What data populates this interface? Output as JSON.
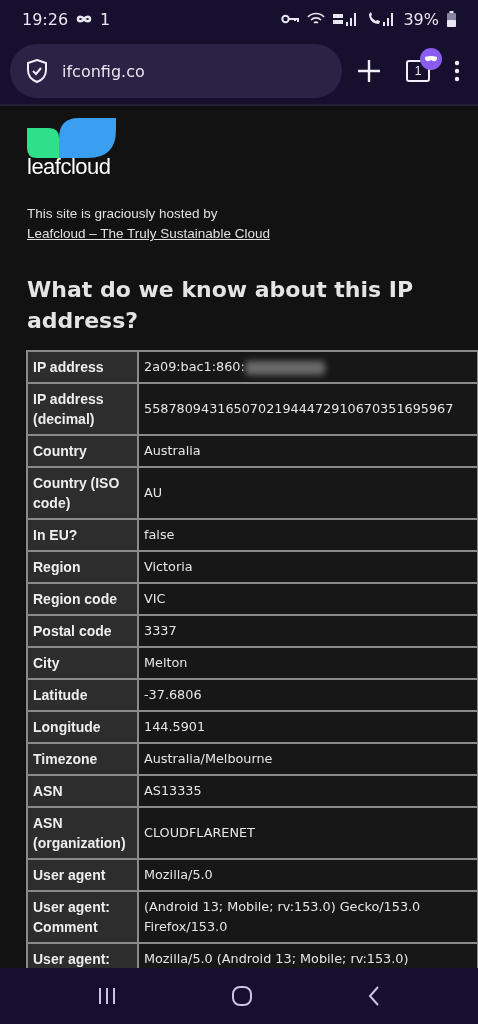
{
  "status_bar": {
    "time": "19:26",
    "notification_count": "1",
    "battery": "39%"
  },
  "browser_toolbar": {
    "url": "ifconfig.co",
    "tab_count": "1"
  },
  "page": {
    "logo_text": "leafcloud",
    "hosted_by": "This site is graciously hosted by",
    "host_link": "Leafcloud – The Truly Sustainable Cloud",
    "heading": "What do we know about this IP address?",
    "table": {
      "rows": [
        {
          "label": "IP address",
          "value": "2a09:bac1:860:",
          "redacted": true
        },
        {
          "label": "IP address (decimal)",
          "value": "55878094316507021944472910670351695967"
        },
        {
          "label": "Country",
          "value": "Australia"
        },
        {
          "label": "Country (ISO code)",
          "value": "AU"
        },
        {
          "label": "In EU?",
          "value": "false"
        },
        {
          "label": "Region",
          "value": "Victoria"
        },
        {
          "label": "Region code",
          "value": "VIC"
        },
        {
          "label": "Postal code",
          "value": "3337"
        },
        {
          "label": "City",
          "value": "Melton"
        },
        {
          "label": "Latitude",
          "value": "-37.6806"
        },
        {
          "label": "Longitude",
          "value": "144.5901"
        },
        {
          "label": "Timezone",
          "value": "Australia/Melbourne"
        },
        {
          "label": "ASN",
          "value": "AS13335"
        },
        {
          "label": "ASN (organization)",
          "value": "CLOUDFLARENET"
        },
        {
          "label": "User agent",
          "value": "Mozilla/5.0"
        },
        {
          "label": "User agent: Comment",
          "value": "(Android 13; Mobile; rv:153.0) Gecko/153.0 Firefox/153.0"
        },
        {
          "label": "User agent:",
          "value": "Mozilla/5.0 (Android 13; Mobile; rv:153.0)"
        }
      ]
    }
  }
}
